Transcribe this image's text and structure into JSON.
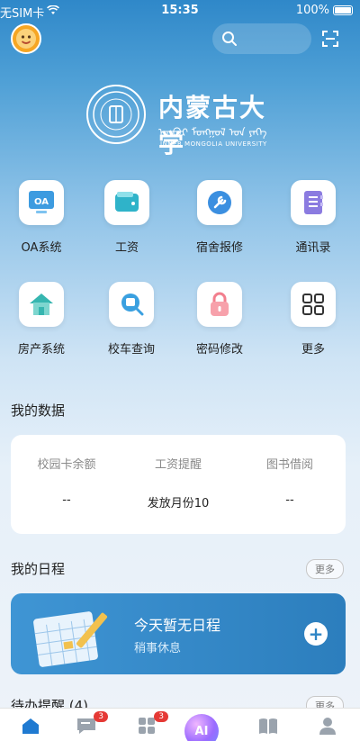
{
  "status_bar": {
    "carrier": "无SIM卡",
    "time": "15:35",
    "battery": "100%"
  },
  "header": {
    "avatar_icon": "cartoon-avatar-icon",
    "search_icon": "search-icon",
    "scan_icon": "scan-icon"
  },
  "logo": {
    "title": "内蒙古大学",
    "mongolian": "ᠦᠪᠦᠷ ᠮᠣᠩᠭᠣᠯ ᠤᠨ ᠶᠡᠬᠡ",
    "english": "INNER MONGOLIA UNIVERSITY"
  },
  "apps": [
    {
      "label": "OA系统",
      "icon": "oa-icon",
      "color": "#3d9be0",
      "icon_text": "OA"
    },
    {
      "label": "工资",
      "icon": "wallet-icon",
      "color": "#2fb3c9"
    },
    {
      "label": "宿舍报修",
      "icon": "wrench-icon",
      "color": "#3b8fe0"
    },
    {
      "label": "通讯录",
      "icon": "address-book-icon",
      "color": "#8b7be0"
    },
    {
      "label": "房产系统",
      "icon": "house-icon",
      "color": "#36b6b0"
    },
    {
      "label": "校车查询",
      "icon": "bus-search-icon",
      "color": "#3aa0e0"
    },
    {
      "label": "密码修改",
      "icon": "lock-icon",
      "color": "#f27f8e"
    },
    {
      "label": "更多",
      "icon": "grid-icon",
      "color": "#333333"
    }
  ],
  "my_data": {
    "title": "我的数据",
    "items": [
      {
        "label": "校园卡余额",
        "value": "--"
      },
      {
        "label": "工资提醒",
        "value": "发放月份10"
      },
      {
        "label": "图书借阅",
        "value": "--"
      }
    ]
  },
  "schedule": {
    "title": "我的日程",
    "more": "更多",
    "empty_title": "今天暂无日程",
    "empty_sub": "稍事休息",
    "add_label": "+"
  },
  "todo": {
    "title": "待办提醒 (4)",
    "more": "更多"
  },
  "tabbar": {
    "messages_badge": "3",
    "apps_badge": "3",
    "ai_label": "AI"
  }
}
